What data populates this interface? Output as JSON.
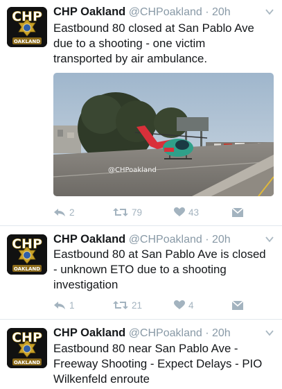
{
  "tweets": [
    {
      "avatar_text": {
        "top": "CHP",
        "bottom": "OAKLAND"
      },
      "name": "CHP Oakland",
      "meta": "@CHPoakland · 20h",
      "text_lines": [
        "Eastbound 80 closed at San Pablo Ave",
        "due to a shooting - one victim",
        "transported by air ambulance."
      ],
      "media_watermark": "@CHPoakland",
      "reply_count": "2",
      "retweet_count": "79",
      "like_count": "43"
    },
    {
      "avatar_text": {
        "top": "CHP",
        "bottom": "OAKLAND"
      },
      "name": "CHP Oakland",
      "meta": "@CHPoakland · 20h",
      "text_lines": [
        "Eastbound 80 at San Pablo Ave is closed",
        "- unknown ETO due to a shooting",
        "investigation"
      ],
      "reply_count": "1",
      "retweet_count": "21",
      "like_count": "4"
    },
    {
      "avatar_text": {
        "top": "CHP",
        "bottom": "OAKLAND"
      },
      "name": "CHP Oakland",
      "meta": "@CHPoakland · 20h",
      "text_lines": [
        "Eastbound 80 near San Pablo Ave -",
        "Freeway Shooting - Expect Delays - PIO",
        "Wilkenfeld enroute"
      ]
    }
  ],
  "icons": {
    "reply": "reply-icon",
    "retweet": "retweet-icon",
    "like": "heart-icon",
    "dm": "envelope-icon",
    "caret": "chevron-down-icon"
  },
  "colors": {
    "name": "#14171a",
    "meta": "#8899a6",
    "action": "#a3b3bf",
    "divider": "#e1e8ed",
    "logo_gold": "#c9a227"
  }
}
